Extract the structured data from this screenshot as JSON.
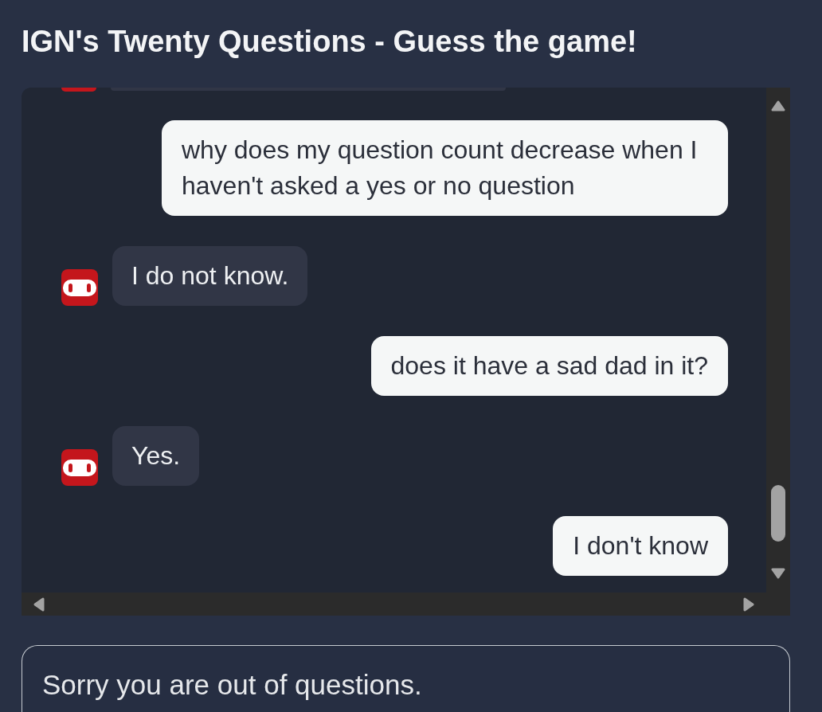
{
  "title": "IGN's Twenty Questions - Guess the game!",
  "messages": [
    {
      "kind": "bot",
      "cut_off": true
    },
    {
      "kind": "user",
      "cut_off": false,
      "text": "why does my question count decrease when I haven't asked a yes or no question"
    },
    {
      "kind": "bot",
      "cut_off": false,
      "text": "I do not know."
    },
    {
      "kind": "user",
      "cut_off": false,
      "text": "does it have a sad dad in it?"
    },
    {
      "kind": "bot",
      "cut_off": false,
      "text": "Yes."
    },
    {
      "kind": "user",
      "cut_off": false,
      "text": "I don't know"
    }
  ],
  "input": {
    "value": "Sorry you are out of questions."
  }
}
